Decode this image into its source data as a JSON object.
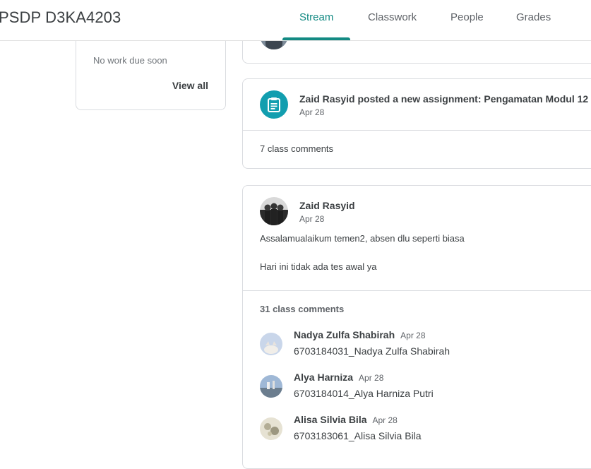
{
  "header": {
    "class_title": "PSDP D3KA4203",
    "tabs": [
      {
        "label": "Stream",
        "active": true
      },
      {
        "label": "Classwork",
        "active": false
      },
      {
        "label": "People",
        "active": false
      },
      {
        "label": "Grades",
        "active": false
      }
    ]
  },
  "upcoming": {
    "empty_text": "No work due soon",
    "view_all": "View all"
  },
  "stream": {
    "assignment_post": {
      "title": "Zaid Rasyid posted a new assignment: Pengamatan Modul 12",
      "date": "Apr 28",
      "comments": "7 class comments",
      "icon": "assignment-icon"
    },
    "announcement": {
      "author": "Zaid Rasyid",
      "date": "Apr 28",
      "line1": "Assalamualaikum temen2, absen dlu seperti biasa",
      "line2": "Hari ini tidak ada tes awal ya",
      "comments_count": "31 class comments",
      "comments": [
        {
          "name": "Nadya Zulfa Shabirah",
          "date": "Apr 28",
          "text": "6703184031_Nadya Zulfa Shabirah"
        },
        {
          "name": "Alya Harniza",
          "date": "Apr 28",
          "text": "6703184014_Alya Harniza Putri"
        },
        {
          "name": "Alisa Silvia Bila",
          "date": "Apr 28",
          "text": "6703183061_Alisa Silvia Bila"
        }
      ]
    }
  },
  "colors": {
    "accent": "#138a83",
    "assignment_icon_bg": "#129eaf"
  }
}
